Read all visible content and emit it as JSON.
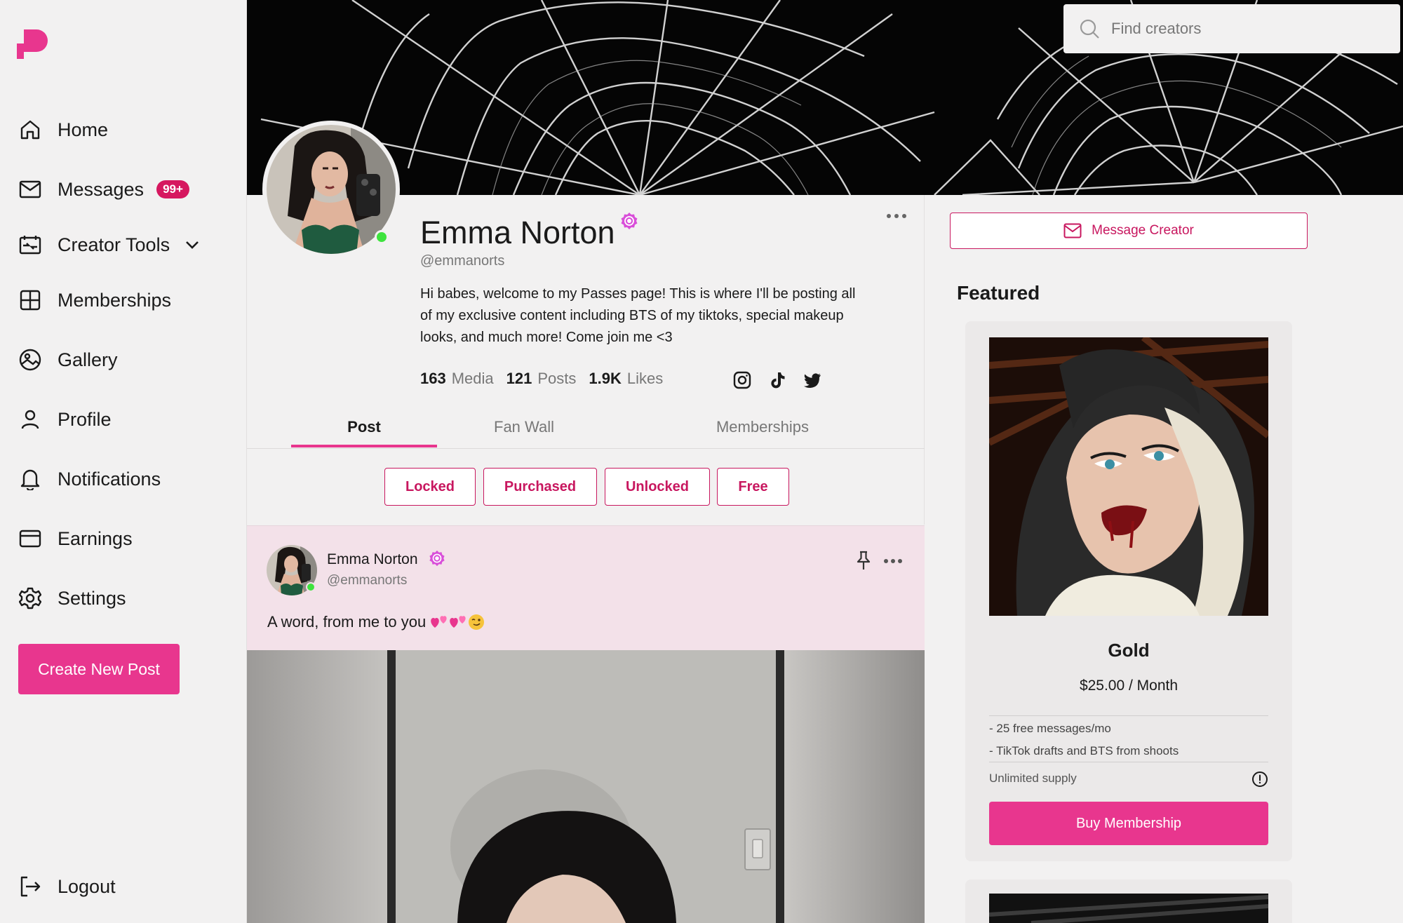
{
  "sidebar": {
    "items": [
      {
        "label": "Home",
        "icon": "home-icon"
      },
      {
        "label": "Messages",
        "icon": "mail-icon",
        "badge": "99+"
      },
      {
        "label": "Creator Tools",
        "icon": "creator-tools-icon"
      },
      {
        "label": "Memberships",
        "icon": "grid-icon"
      },
      {
        "label": "Gallery",
        "icon": "gallery-icon"
      },
      {
        "label": "Profile",
        "icon": "user-icon"
      },
      {
        "label": "Notifications",
        "icon": "bell-icon"
      },
      {
        "label": "Earnings",
        "icon": "credit-card-icon"
      },
      {
        "label": "Settings",
        "icon": "gear-icon"
      }
    ],
    "create_label": "Create New Post",
    "logout_label": "Logout"
  },
  "search": {
    "placeholder": "Find creators"
  },
  "profile": {
    "name": "Emma Norton",
    "handle": "@emmanorts",
    "bio": "Hi babes, welcome to my Passes page! This is where I'll be posting all of my exclusive content including BTS of my tiktoks, special makeup looks, and much more! Come join me <3",
    "stats": [
      {
        "value": "163",
        "unit": "Media"
      },
      {
        "value": "121",
        "unit": "Posts"
      },
      {
        "value": "1.9K",
        "unit": "Likes"
      }
    ]
  },
  "tabs": [
    "Post",
    "Fan Wall",
    "Memberships"
  ],
  "filters": [
    "Locked",
    "Purchased",
    "Unlocked",
    "Free"
  ],
  "post": {
    "name": "Emma Norton",
    "handle": "@emmanorts",
    "caption": "A word, from me to you"
  },
  "right": {
    "message_label": "Message Creator",
    "featured_title": "Featured",
    "tier": {
      "name": "Gold",
      "price": "$25.00 / Month",
      "perks": [
        "- 25 free messages/mo",
        "- TikTok drafts and BTS from shoots"
      ],
      "supply": "Unlimited supply",
      "buy_label": "Buy Membership"
    }
  },
  "colors": {
    "accent": "#e8368e",
    "accent_dark": "#c8175f",
    "online": "#3ee33e"
  }
}
